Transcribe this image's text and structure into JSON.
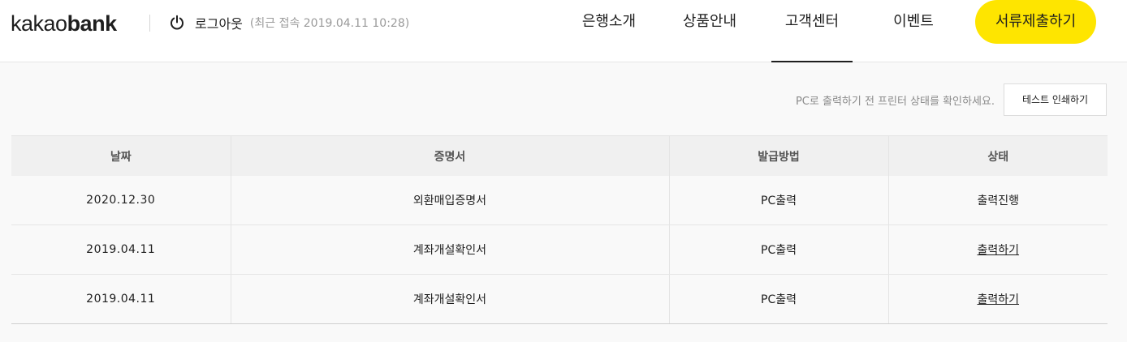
{
  "header": {
    "logo_light": "kakao",
    "logo_bold": "bank",
    "logout_label": "로그아웃",
    "last_access": "(최근 접속 2019.04.11 10:28)",
    "nav": [
      {
        "label": "은행소개",
        "active": false
      },
      {
        "label": "상품안내",
        "active": false
      },
      {
        "label": "고객센터",
        "active": true
      },
      {
        "label": "이벤트",
        "active": false
      }
    ],
    "submit_button": "서류제출하기",
    "accent_color": "#fee500"
  },
  "print_notice": "PC로 출력하기 전 프린터 상태를 확인하세요.",
  "test_print_button": "테스트 인쇄하기",
  "table": {
    "columns": [
      "날짜",
      "증명서",
      "발급방법",
      "상태"
    ],
    "rows": [
      {
        "date": "2020.12.30",
        "certificate": "외환매입증명서",
        "method": "PC출력",
        "status": "출력진행",
        "status_is_link": false
      },
      {
        "date": "2019.04.11",
        "certificate": "계좌개설확인서",
        "method": "PC출력",
        "status": "출력하기",
        "status_is_link": true
      },
      {
        "date": "2019.04.11",
        "certificate": "계좌개설확인서",
        "method": "PC출력",
        "status": "출력하기",
        "status_is_link": true
      }
    ]
  }
}
